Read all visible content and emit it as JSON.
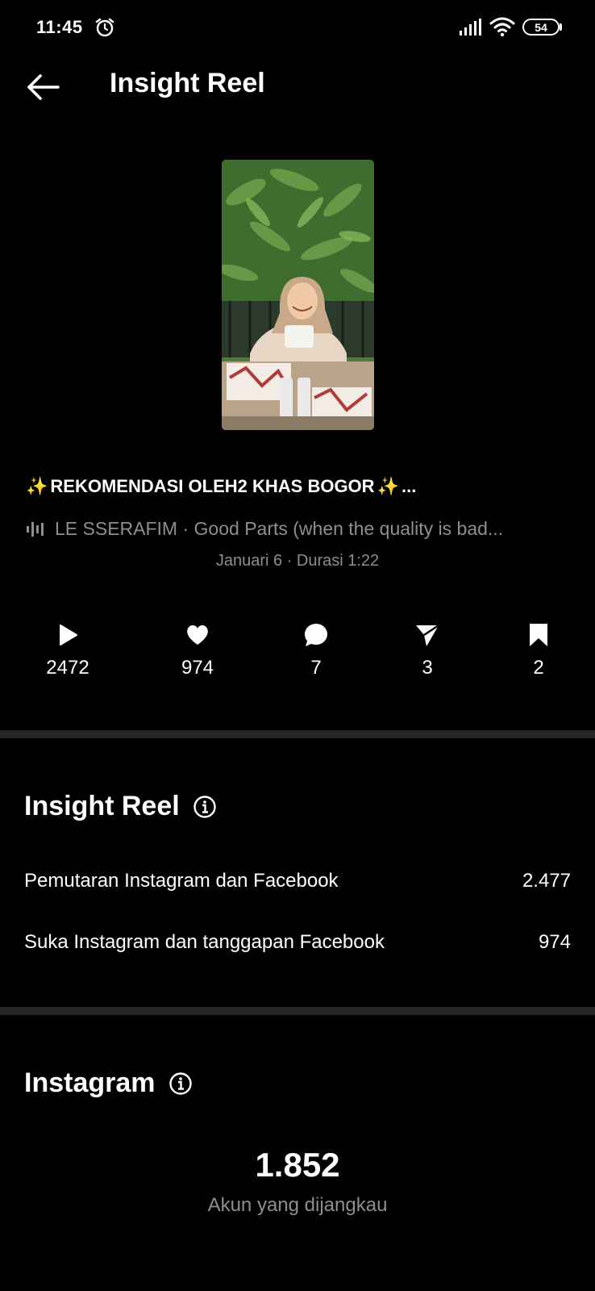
{
  "status_bar": {
    "time": "11:45",
    "battery": "54"
  },
  "header": {
    "title": "Insight Reel"
  },
  "reel": {
    "caption_sparkle_left": "✨",
    "caption": "REKOMENDASI OLEH2 KHAS BOGOR",
    "caption_sparkle_right": "✨",
    "caption_ellipsis": "...",
    "audio": "LE SSERAFIM · Good Parts (when the quality is bad...",
    "meta": "Januari 6 · Durasi 1:22"
  },
  "stats": {
    "plays": "2472",
    "likes": "974",
    "comments": "7",
    "shares": "3",
    "saves": "2"
  },
  "insight_section": {
    "title": "Insight Reel",
    "rows": [
      {
        "label": "Pemutaran Instagram dan Facebook",
        "value": "2.477"
      },
      {
        "label": "Suka Instagram dan tanggapan Facebook",
        "value": "974"
      }
    ]
  },
  "instagram_section": {
    "title": "Instagram",
    "accounts_reached": "1.852",
    "accounts_reached_label": "Akun yang dijangkau"
  },
  "colors": {
    "background": "#000000",
    "muted_text": "#8e8e8e",
    "divider": "#262626",
    "sparkle": "#f4d04d"
  }
}
